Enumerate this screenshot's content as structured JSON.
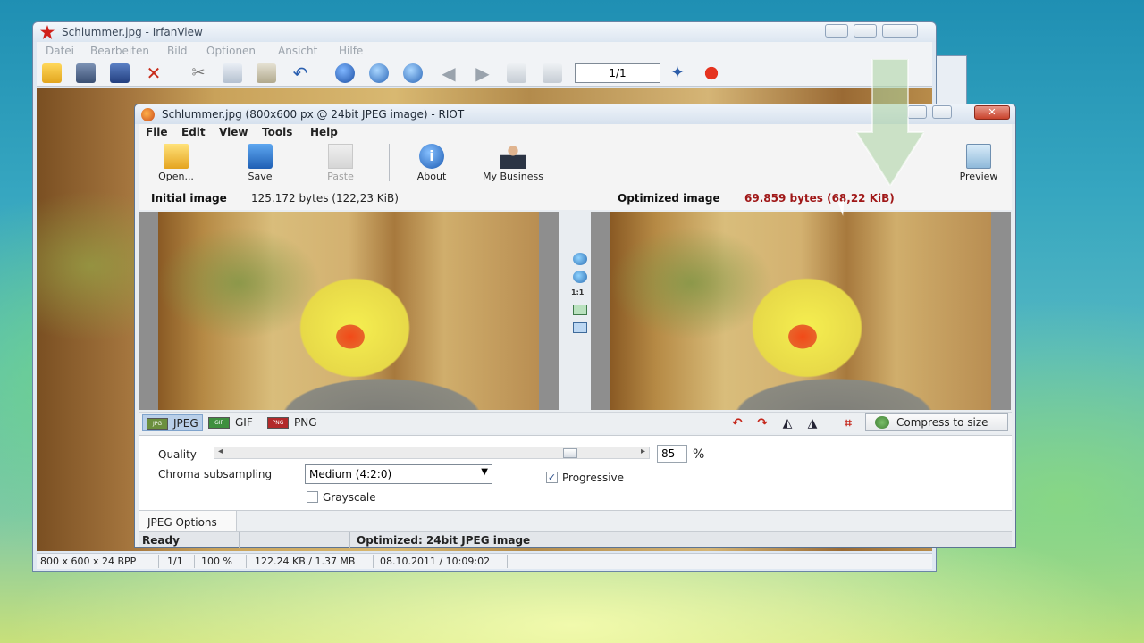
{
  "irfanview": {
    "title": "Schlummer.jpg - IrfanView",
    "menu": [
      "Datei",
      "Bearbeiten",
      "Bild",
      "Optionen",
      "Ansicht",
      "Hilfe"
    ],
    "page_counter": "1/1",
    "status": {
      "dims": "800 x 600 x 24 BPP",
      "page": "1/1",
      "zoom": "100 %",
      "size": "122.24 KB / 1.37 MB",
      "date": "08.10.2011 / 10:09:02"
    }
  },
  "riot": {
    "title": "Schlummer.jpg (800x600 px @ 24bit JPEG image) - RIOT",
    "menu": [
      "File",
      "Edit",
      "View",
      "Tools",
      "Help"
    ],
    "toolbar": {
      "open": "Open...",
      "save": "Save",
      "paste": "Paste",
      "about": "About",
      "my_business": "My Business",
      "preview": "Preview"
    },
    "initial": {
      "label": "Initial image",
      "size": "125.172 bytes (122,23 KiB)"
    },
    "optimized": {
      "label": "Optimized image",
      "size": "69.859 bytes (68,22 KiB)"
    },
    "mid_zoom_label": "1:1",
    "formats": [
      "JPEG",
      "GIF",
      "PNG"
    ],
    "compress_to_size": "Compress to size",
    "quality_label": "Quality",
    "quality_value": "85",
    "quality_unit": "%",
    "quality_fraction": 0.85,
    "chroma_label": "Chroma subsampling",
    "chroma_value": "Medium (4:2:0)",
    "grayscale_label": "Grayscale",
    "progressive_label": "Progressive",
    "options_tab": "JPEG Options",
    "status_ready": "Ready",
    "status_optimized": "Optimized: 24bit JPEG image"
  }
}
